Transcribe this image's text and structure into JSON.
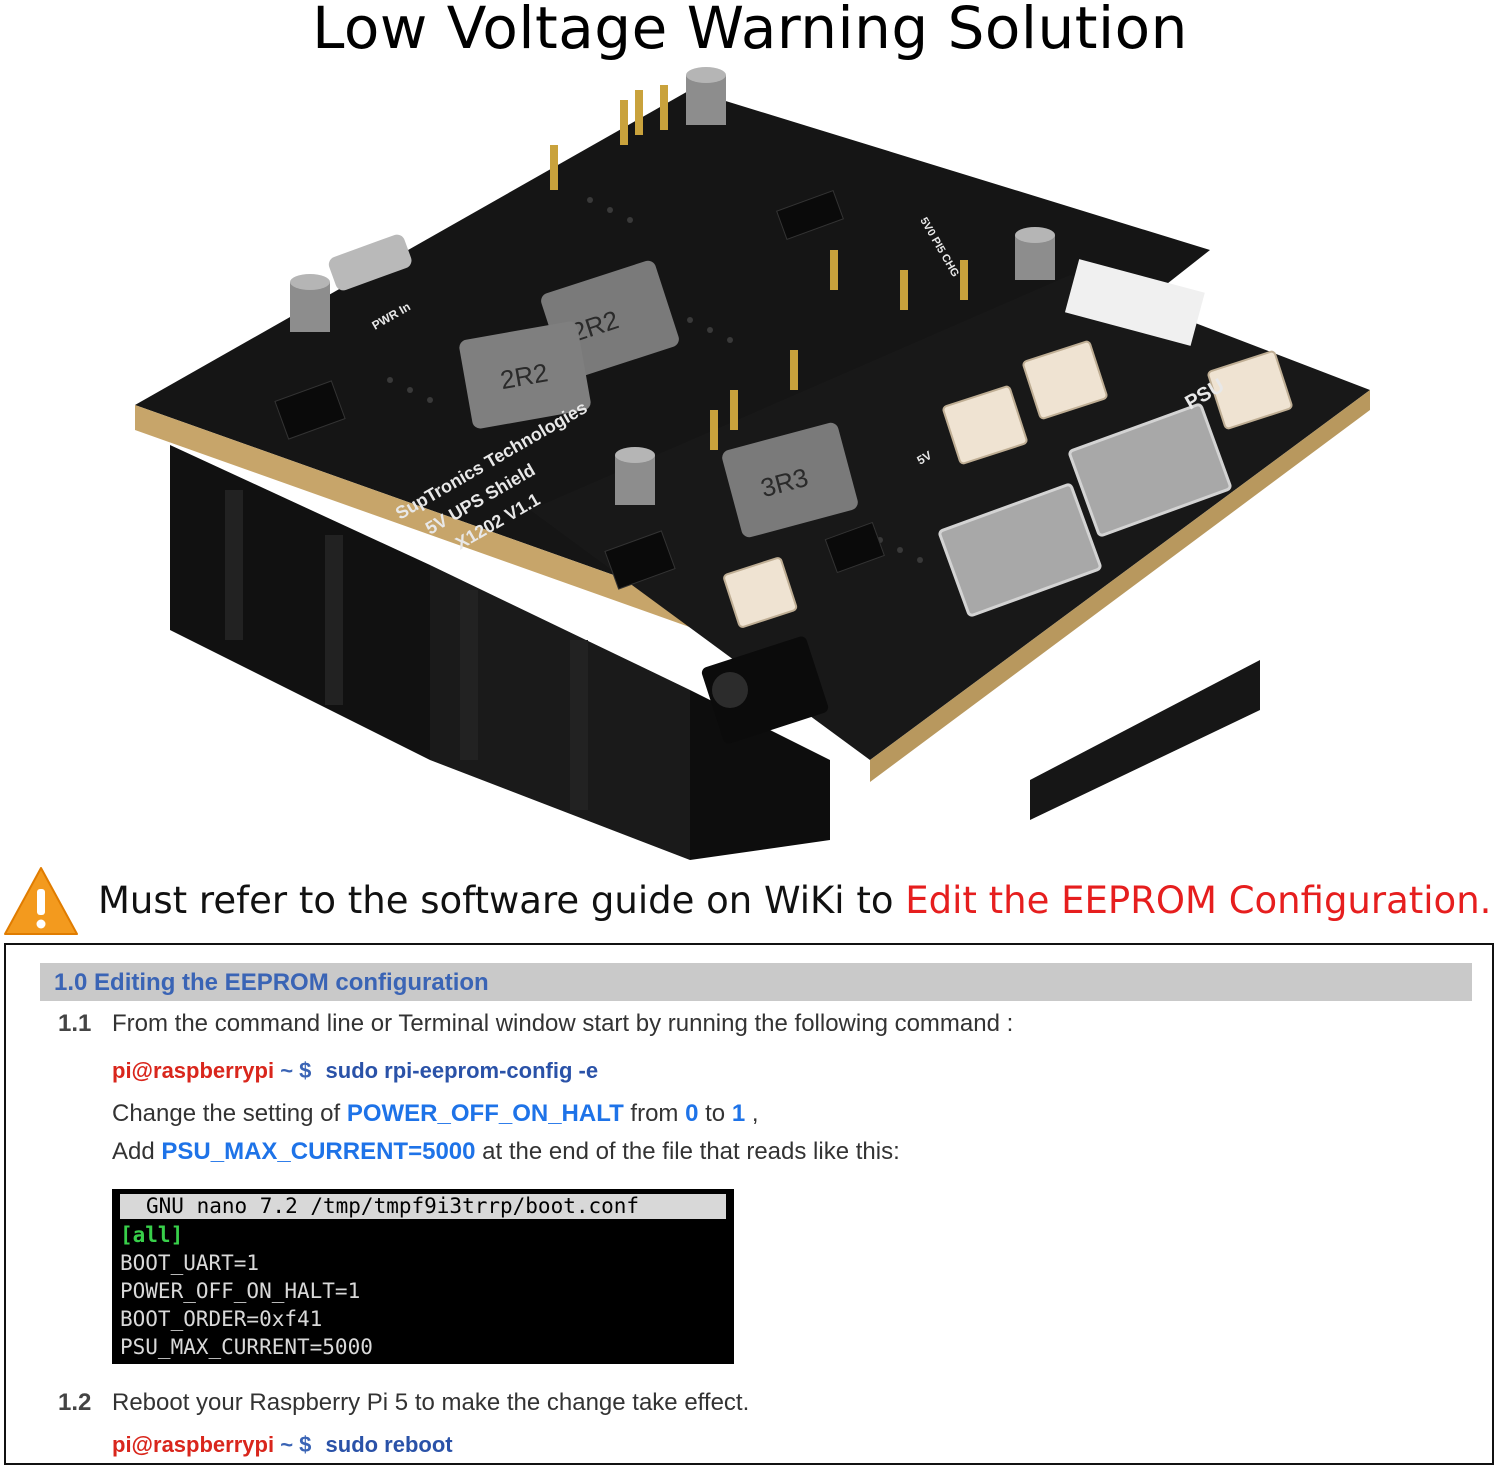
{
  "title": "Low Voltage Warning Solution",
  "board": {
    "labels": {
      "brand": "SupTronics Technologies",
      "model": "5V UPS Shield",
      "part": "X1202 V1.1",
      "inductor_a": "2R2",
      "inductor_b": "2R2",
      "inductor_c": "3R3",
      "pwr_in": "PWR In",
      "psu": "PSU",
      "v5": "5V",
      "pins": "5V0 PI5 CHG"
    }
  },
  "warning": {
    "icon": "warning-triangle-icon",
    "text_prefix": "Must refer to the software guide on WiKi to",
    "text_highlight": "Edit the EEPROM Configuration."
  },
  "guide": {
    "section_title": "1.0 Editing the EEPROM configuration",
    "step1": {
      "num": "1.1",
      "text": "From the command line or Terminal window start by running the following command :"
    },
    "cmd1": {
      "prompt": "pi@raspberrypi",
      "tilde": "~ $",
      "command": "sudo rpi-eeprom-config -e"
    },
    "change": {
      "a": "Change the setting of",
      "key": "POWER_OFF_ON_HALT",
      "b": "from",
      "from": "0",
      "c": "to",
      "to": "1",
      "d": ","
    },
    "add": {
      "a": "Add",
      "key": "PSU_MAX_CURRENT=5000",
      "b": "at the end of the file that reads like this:"
    },
    "terminal": {
      "header": "GNU nano 7.2 /tmp/tmpf9i3trrp/boot.conf",
      "lines": [
        "[all]",
        "BOOT_UART=1",
        "POWER_OFF_ON_HALT=1",
        "BOOT_ORDER=0xf41",
        "PSU_MAX_CURRENT=5000"
      ]
    },
    "step2": {
      "num": "1.2",
      "text": "Reboot your Raspberry Pi 5 to make the change take effect."
    },
    "cmd2": {
      "prompt": "pi@raspberrypi",
      "tilde": "~ $",
      "command": "sudo reboot"
    }
  },
  "colors": {
    "accent_red": "#e61e1e",
    "link_blue": "#1e73e8",
    "heading_blue": "#3a64b5",
    "terminal_green": "#38d04a"
  }
}
